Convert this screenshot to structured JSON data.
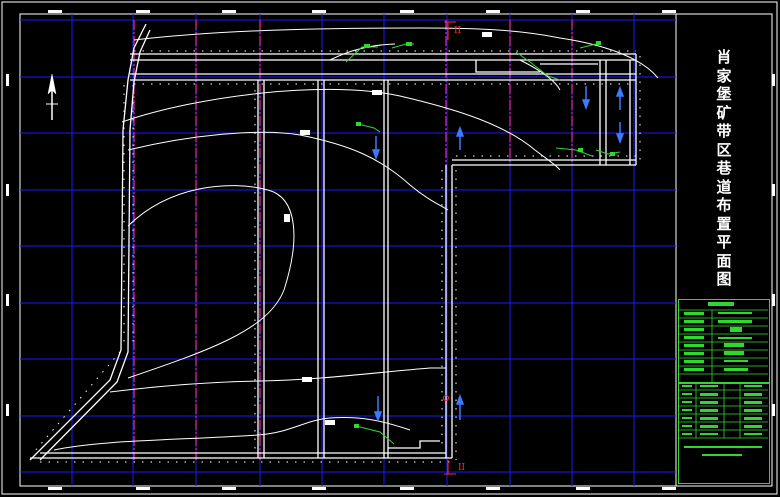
{
  "title_block": {
    "title_chars": [
      "肖",
      "家",
      "堡",
      "矿",
      "带",
      "区",
      "巷",
      "道",
      "布",
      "置",
      "平",
      "面",
      "图"
    ]
  },
  "section_marks": {
    "top": "II",
    "bottom": "II"
  },
  "colors": {
    "background": "#000000",
    "grid": "#1a1aff",
    "roadway": "#ffffff",
    "boundary": "#c02080",
    "annotation": "#2fd82f",
    "section_mark": "#ff3030"
  },
  "icons": {
    "north_arrow": "north-arrow-icon"
  }
}
